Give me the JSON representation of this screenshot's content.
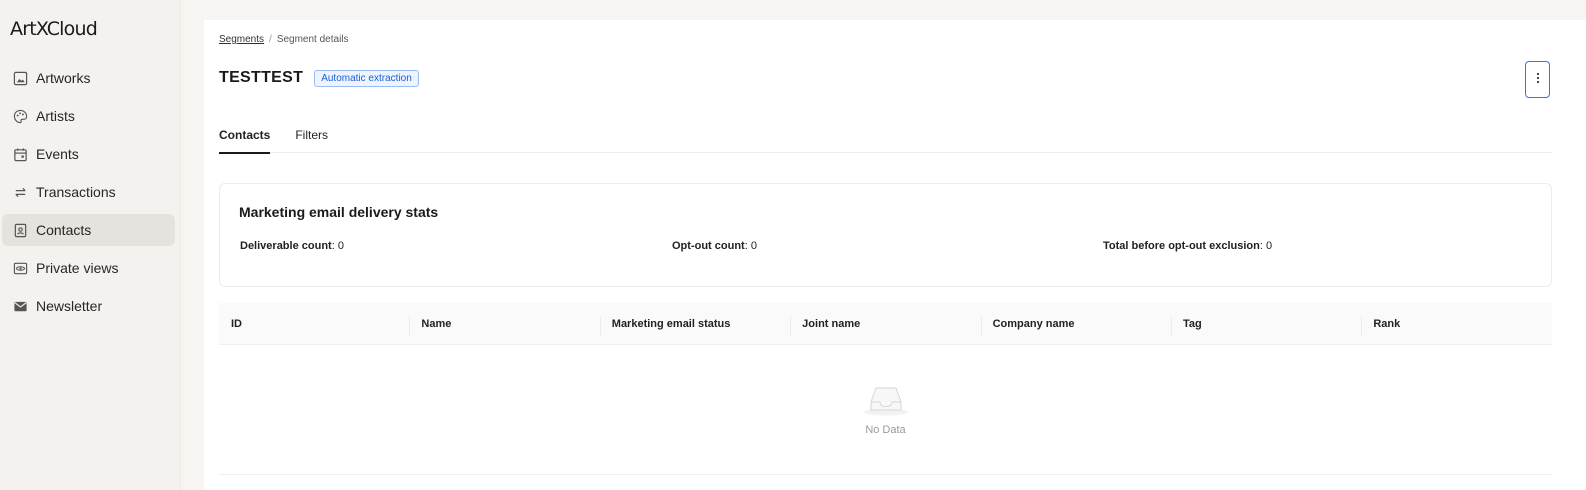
{
  "app": {
    "logo": "ArtXCloud"
  },
  "sidebar": {
    "items": [
      {
        "label": "Artworks",
        "icon": "image-icon"
      },
      {
        "label": "Artists",
        "icon": "palette-icon"
      },
      {
        "label": "Events",
        "icon": "calendar-icon"
      },
      {
        "label": "Transactions",
        "icon": "swap-arrows-icon"
      },
      {
        "label": "Contacts",
        "icon": "contact-card-icon",
        "active": true
      },
      {
        "label": "Private views",
        "icon": "eye-icon"
      },
      {
        "label": "Newsletter",
        "icon": "mail-icon"
      }
    ]
  },
  "breadcrumb": {
    "root": "Segments",
    "separator": "/",
    "current": "Segment details"
  },
  "header": {
    "title": "TESTTEST",
    "badge": "Automatic extraction",
    "more_icon": "more-vertical-icon"
  },
  "tabs": [
    {
      "label": "Contacts",
      "active": true
    },
    {
      "label": "Filters",
      "active": false
    }
  ],
  "stats": {
    "title": "Marketing email delivery stats",
    "items": [
      {
        "label": "Deliverable count",
        "value": "0"
      },
      {
        "label": "Opt-out count",
        "value": "0"
      },
      {
        "label": "Total before opt-out exclusion",
        "value": "0"
      }
    ]
  },
  "table": {
    "columns": [
      "ID",
      "Name",
      "Marketing email status",
      "Joint name",
      "Company name",
      "Tag",
      "Rank"
    ],
    "empty_text": "No Data",
    "empty_icon": "inbox-icon"
  },
  "colors": {
    "accent": "#1d5fcf",
    "sidebar_bg": "#f3f2ee",
    "active_item_bg": "#e4e3de"
  }
}
